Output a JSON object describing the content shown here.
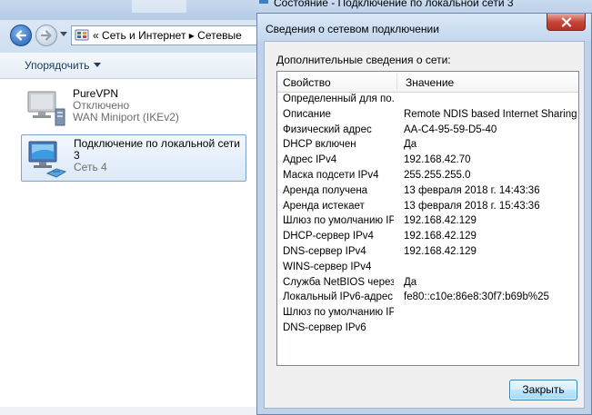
{
  "explorer": {
    "address": {
      "chevrons": "«",
      "crumb1": "Сеть и Интернет",
      "sep": "▸",
      "crumb2": "Сетевые"
    },
    "toolbar": {
      "organize_label": "Упорядочить"
    },
    "connections": [
      {
        "name": "PureVPN",
        "status": "Отключено",
        "device": "WAN Miniport (IKEv2)",
        "icon": "vpn-connection-icon"
      },
      {
        "name": "Подключение по локальной сети 3",
        "status": "Сеть 4",
        "icon": "lan-connection-icon"
      }
    ]
  },
  "status_window": {
    "title": "Состояние - Подключение по локальной сети 3"
  },
  "dialog": {
    "title": "Сведения о сетевом подключении",
    "caption": "Дополнительные сведения о сети:",
    "columns": {
      "property": "Свойство",
      "value": "Значение"
    },
    "rows": [
      {
        "property": "Определенный для по...",
        "value": ""
      },
      {
        "property": "Описание",
        "value": "Remote NDIS based Internet Sharing Dev"
      },
      {
        "property": "Физический адрес",
        "value": "AA-C4-95-59-D5-40"
      },
      {
        "property": "DHCP включен",
        "value": "Да"
      },
      {
        "property": "Адрес IPv4",
        "value": "192.168.42.70"
      },
      {
        "property": "Маска подсети IPv4",
        "value": "255.255.255.0"
      },
      {
        "property": "Аренда получена",
        "value": "13 февраля 2018 г. 14:43:36"
      },
      {
        "property": "Аренда истекает",
        "value": "13 февраля 2018 г. 15:43:36"
      },
      {
        "property": "Шлюз по умолчанию IP...",
        "value": "192.168.42.129"
      },
      {
        "property": "DHCP-сервер IPv4",
        "value": "192.168.42.129"
      },
      {
        "property": "DNS-сервер IPv4",
        "value": "192.168.42.129"
      },
      {
        "property": "WINS-сервер IPv4",
        "value": ""
      },
      {
        "property": "Служба NetBIOS через...",
        "value": "Да"
      },
      {
        "property": "Локальный IPv6-адрес...",
        "value": "fe80::c10e:86e8:30f7:b69b%25"
      },
      {
        "property": "Шлюз по умолчанию IP...",
        "value": ""
      },
      {
        "property": "DNS-сервер IPv6",
        "value": ""
      }
    ],
    "close_label": "Закрыть"
  },
  "colors": {
    "close_button_red": "#c7463a",
    "selection_border": "#7da2ce",
    "dialog_frame": "#bfd2ea"
  }
}
